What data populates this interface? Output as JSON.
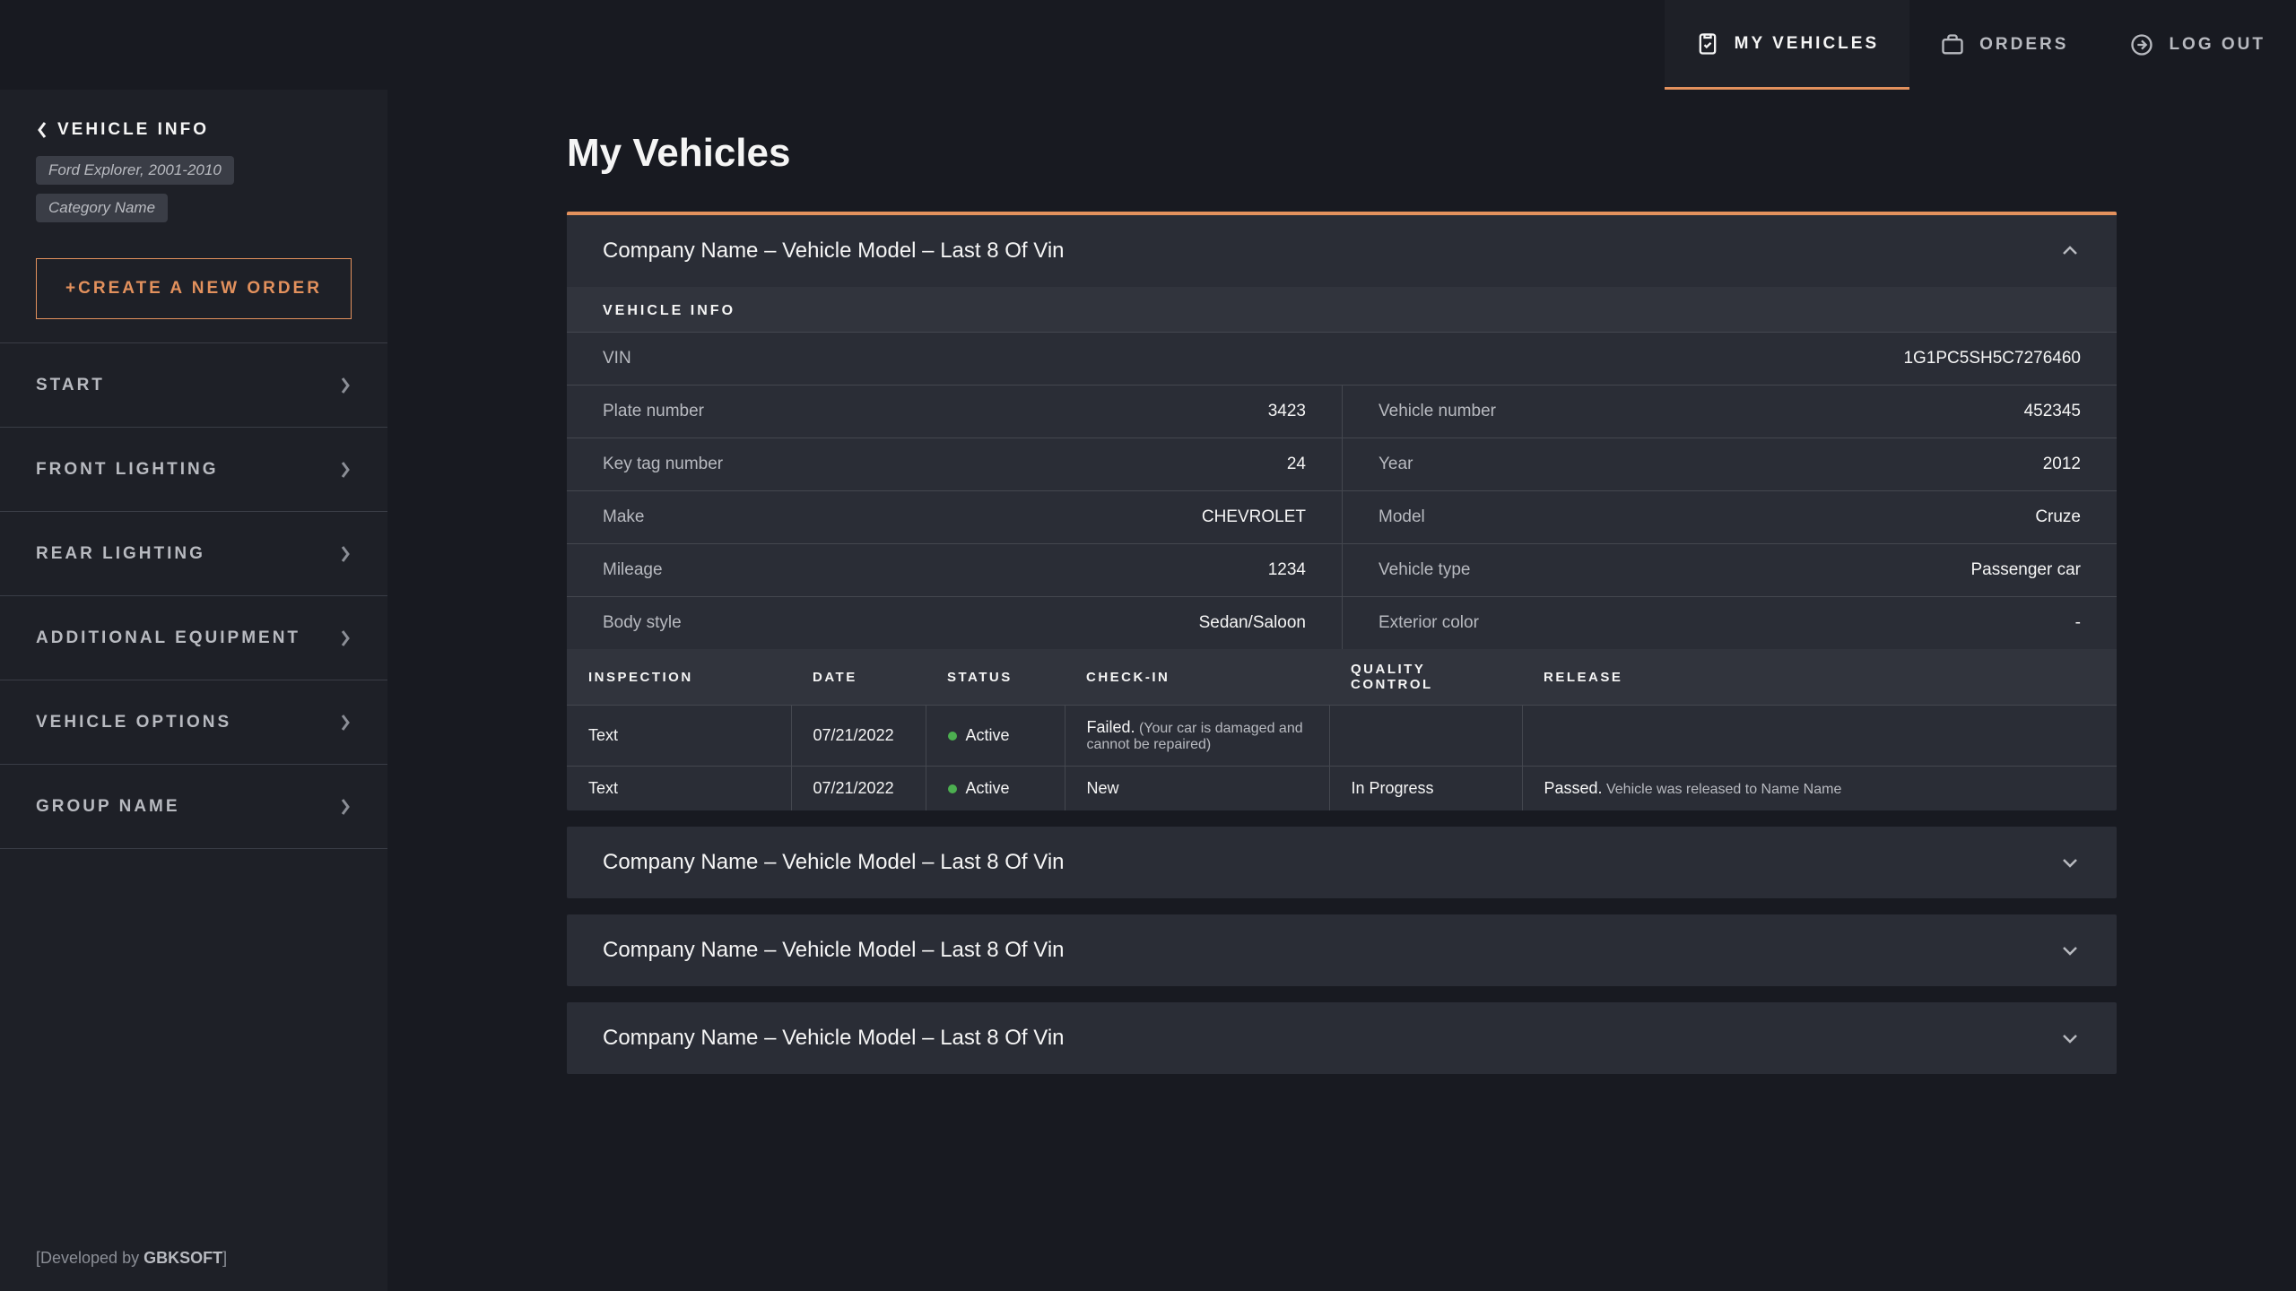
{
  "nav": {
    "my_vehicles": "MY VEHICLES",
    "orders": "ORDERS",
    "log_out": "LOG OUT"
  },
  "sidebar": {
    "title": "VEHICLE INFO",
    "chip_vehicle": "Ford Explorer, 2001-2010",
    "chip_category": "Category Name",
    "create": "+CREATE A NEW ORDER",
    "items": [
      "START",
      "FRONT LIGHTING",
      "REAR LIGHTING",
      "ADDITIONAL EQUIPMENT",
      "VEHICLE OPTIONS",
      "GROUP NAME"
    ],
    "footer_pre": "[Developed by ",
    "footer_bold": "GBKSOFT",
    "footer_post": "]"
  },
  "page": {
    "title": "My Vehicles"
  },
  "acc": {
    "title": "Company Name – Vehicle Model – Last 8 Of Vin",
    "section_label": "VEHICLE INFO",
    "vin_label": "VIN",
    "vin": "1G1PC5SH5C7276460",
    "rows": [
      {
        "l1": "Plate number",
        "v1": "3423",
        "l2": "Vehicle number",
        "v2": "452345"
      },
      {
        "l1": "Key tag number",
        "v1": "24",
        "l2": "Year",
        "v2": "2012"
      },
      {
        "l1": "Make",
        "v1": "CHEVROLET",
        "l2": "Model",
        "v2": "Cruze"
      },
      {
        "l1": "Mileage",
        "v1": "1234",
        "l2": "Vehicle type",
        "v2": "Passenger car"
      },
      {
        "l1": "Body style",
        "v1": "Sedan/Saloon",
        "l2": "Exterior color",
        "v2": "-"
      }
    ],
    "thead": [
      "INSPECTION",
      "DATE",
      "STATUS",
      "CHECK-IN",
      "QUALITY CONTROL",
      "RELEASE"
    ],
    "tbody": [
      {
        "insp": "Text",
        "date": "07/21/2022",
        "status": "Active",
        "check_strong": "Failed.",
        "check_note": " (Your car is damaged and cannot be repaired)",
        "qc": "",
        "rel_strong": "",
        "rel_note": ""
      },
      {
        "insp": "Text",
        "date": "07/21/2022",
        "status": "Active",
        "check_strong": "New",
        "check_note": "",
        "qc": "In Progress",
        "rel_strong": "Passed.",
        "rel_note": " Vehicle was released to Name Name"
      }
    ],
    "collapsed": [
      "Company Name – Vehicle Model – Last 8 Of Vin",
      "Company Name – Vehicle Model – Last 8 Of Vin",
      "Company Name – Vehicle Model – Last 8 Of Vin"
    ]
  }
}
